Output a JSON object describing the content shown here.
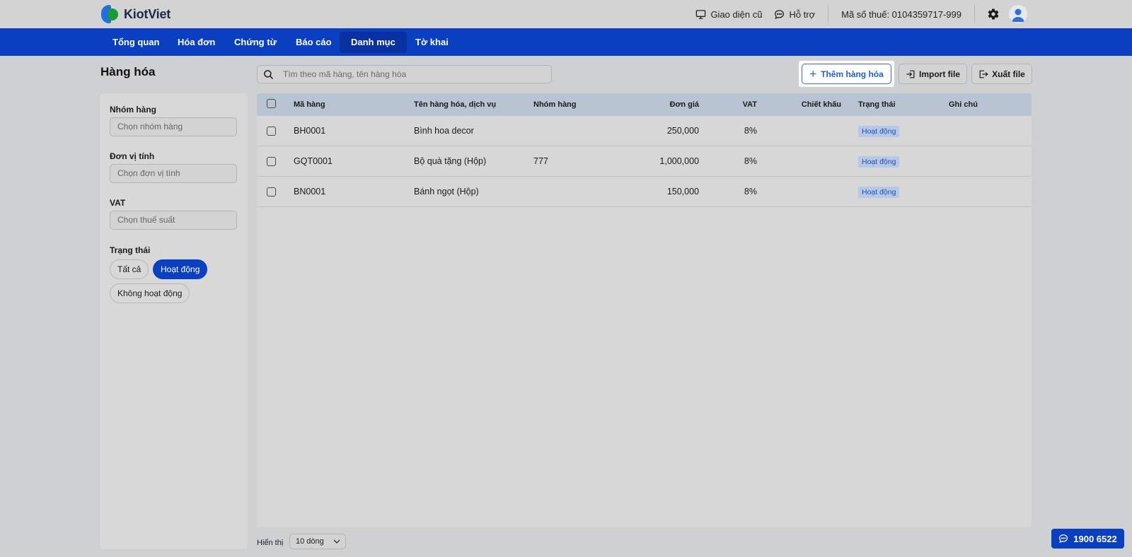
{
  "brand": {
    "name": "KiotViet"
  },
  "header": {
    "old_ui_label": "Giao diện cũ",
    "support_label": "Hỗ trợ",
    "tax_code": "Mã số thuế: 0104359717-999"
  },
  "nav": {
    "items": [
      {
        "label": "Tổng quan"
      },
      {
        "label": "Hóa đơn"
      },
      {
        "label": "Chứng từ"
      },
      {
        "label": "Báo cáo"
      },
      {
        "label": "Danh mục",
        "active": true
      },
      {
        "label": "Tờ khai"
      }
    ]
  },
  "page": {
    "title": "Hàng hóa"
  },
  "filters": {
    "group": {
      "label": "Nhóm hàng",
      "placeholder": "Chọn nhóm hàng"
    },
    "unit": {
      "label": "Đơn vị tính",
      "placeholder": "Chọn đơn vị tính"
    },
    "vat": {
      "label": "VAT",
      "placeholder": "Chọn thuế suất"
    },
    "status": {
      "label": "Trạng thái",
      "options": [
        "Tất cả",
        "Hoạt động",
        "Không hoạt động"
      ],
      "selected": "Hoạt động"
    }
  },
  "search": {
    "placeholder": "Tìm theo mã hàng, tên hàng hóa"
  },
  "actions": {
    "add_label": "Thêm hàng hóa",
    "import_label": "Import file",
    "export_label": "Xuất file"
  },
  "table": {
    "columns": [
      "Mã hàng",
      "Tên hàng hóa, dịch vụ",
      "Nhóm hàng",
      "Đơn giá",
      "VAT",
      "Chiết khấu",
      "Trạng thái",
      "Ghi chú"
    ],
    "rows": [
      {
        "code": "BH0001",
        "name": "Bình hoa decor",
        "group": "",
        "price": "250,000",
        "vat": "8%",
        "discount": "",
        "status": "Hoạt động",
        "note": ""
      },
      {
        "code": "GQT0001",
        "name": "Bộ quà tặng (Hộp)",
        "group": "777",
        "price": "1,000,000",
        "vat": "8%",
        "discount": "",
        "status": "Hoạt động",
        "note": ""
      },
      {
        "code": "BN0001",
        "name": "Bánh ngọt (Hộp)",
        "group": "",
        "price": "150,000",
        "vat": "8%",
        "discount": "",
        "status": "Hoạt động",
        "note": ""
      }
    ]
  },
  "footer": {
    "show_label": "Hiển thị",
    "page_size": "10 dòng"
  },
  "hotline": {
    "number": "1900 6522"
  },
  "colors": {
    "primary": "#0b3fc2",
    "badge_bg": "#b7c8e6",
    "badge_text": "#1c4fb8"
  }
}
